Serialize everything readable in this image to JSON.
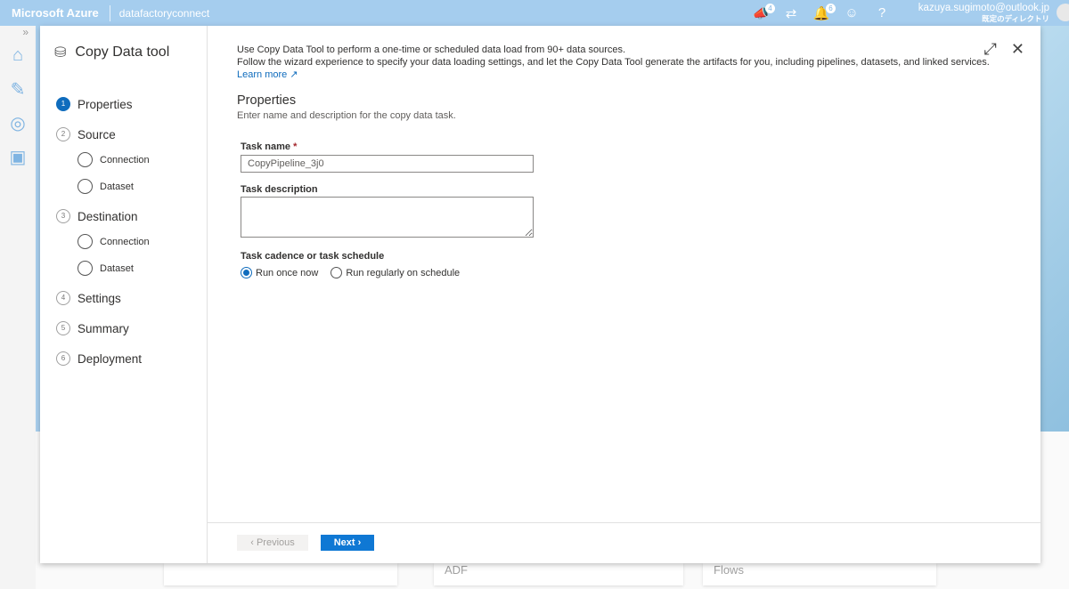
{
  "topbar": {
    "brand": "Microsoft Azure",
    "factory": "datafactoryconnect",
    "feedback_badge": "4",
    "notif_badge": "6",
    "help": "?",
    "user_email": "kazuya.sugimoto@outlook.jp",
    "user_directory": "既定のディレクトリ"
  },
  "rail": {
    "expand": "»"
  },
  "panel": {
    "title": "Copy Data tool",
    "steps": [
      {
        "num": "1",
        "label": "Properties"
      },
      {
        "num": "2",
        "label": "Source"
      },
      {
        "num": "3",
        "label": "Destination"
      },
      {
        "num": "4",
        "label": "Settings"
      },
      {
        "num": "5",
        "label": "Summary"
      },
      {
        "num": "6",
        "label": "Deployment"
      }
    ],
    "substeps": {
      "connection": "Connection",
      "dataset": "Dataset"
    }
  },
  "content": {
    "intro1": "Use Copy Data Tool to perform a one-time or scheduled data load from 90+ data sources.",
    "intro2": "Follow the wizard experience to specify your data loading settings, and let the Copy Data Tool generate the artifacts for you, including pipelines, datasets, and linked services.",
    "learn_more": "Learn more",
    "heading": "Properties",
    "subheading": "Enter name and description for the copy data task.",
    "task_name_label": "Task name",
    "required": "*",
    "task_name_value": "CopyPipeline_3j0",
    "task_desc_label": "Task description",
    "cadence_label": "Task cadence or task schedule",
    "radio_once": "Run once now",
    "radio_schedule": "Run regularly on schedule"
  },
  "footer": {
    "previous": "‹ Previous",
    "next": "Next ›"
  },
  "background_cards": [
    "ADF",
    "Flows"
  ]
}
